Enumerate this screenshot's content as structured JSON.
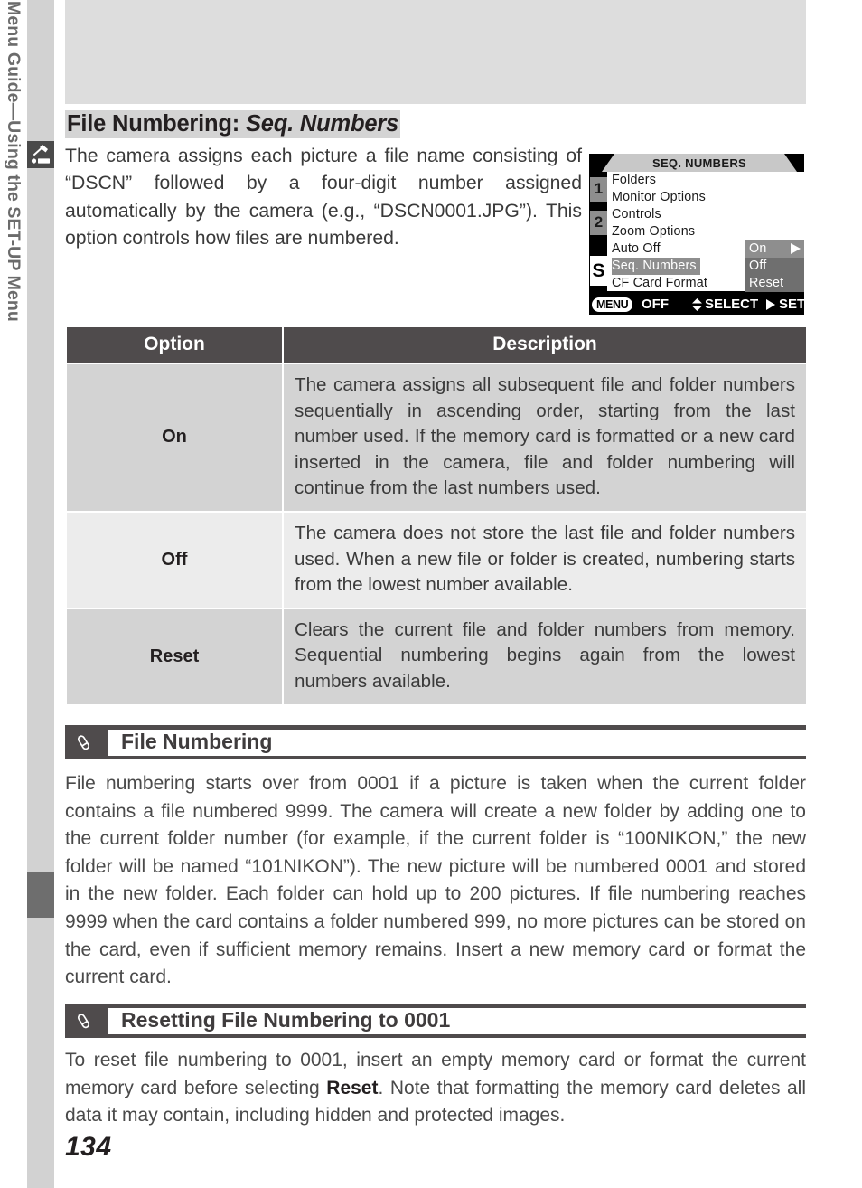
{
  "sidebar": {
    "icon": "setup-wrench-icon",
    "label": "Menu Guide—Using the SET-UP Menu"
  },
  "page": {
    "number": "134"
  },
  "section": {
    "title_plain": "File Numbering: ",
    "title_italic": "Seq. Numbers",
    "intro": "The camera assigns each picture a file name consisting of “DSCN” followed by a four-digit number assigned automatically by the camera (e.g., “DSCN0001.JPG”).  This option controls how files are numbered."
  },
  "lcd": {
    "title": "SEQ. NUMBERS",
    "tabs": [
      "1",
      "2",
      "S"
    ],
    "menu_items": [
      "Folders",
      "Monitor Options",
      "Controls",
      "Zoom Options",
      "Auto Off",
      "Seq. Numbers",
      "CF Card Format"
    ],
    "selected_item": "Seq. Numbers",
    "values": [
      "On",
      "Off",
      "Reset"
    ],
    "highlighted_value": "On",
    "status": {
      "menu_pill": "MENU",
      "off_label": "OFF",
      "select_label": "SELECT",
      "set_label": "SET"
    }
  },
  "table": {
    "headers": [
      "Option",
      "Description"
    ],
    "rows": [
      {
        "option": "On",
        "description": "The camera assigns all subsequent file and folder numbers sequentially in ascending order, starting from the last number used. If the memory card is formatted or a new card inserted in the camera, file and folder numbering will continue from the last numbers used."
      },
      {
        "option": "Off",
        "description": "The camera does not store the last file and folder numbers used. When a new file or folder is created, numbering starts from the lowest number available."
      },
      {
        "option": "Reset",
        "description": "Clears the current file and folder numbers from memory. Sequential numbering begins again from the lowest numbers available."
      }
    ]
  },
  "notes": [
    {
      "icon": "pencil-note-icon",
      "title": "File Numbering",
      "body_part1": "File numbering starts over from 0001 if a picture is taken when the current folder contains a file numbered 9999.  The camera will create a new folder by adding one to the current folder number (for example, if the current folder is “100NIKON,” the new folder will be named “101NIKON”).  The new picture will be numbered 0001 and stored in the new folder.  Each folder can hold up to 200 pictures.  If file numbering reaches 9999 when the card contains a folder numbered 999, no more pictures can be stored on the card, even if sufficient memory remains.  Insert a new memory card or format the current card."
    },
    {
      "icon": "pencil-note-icon",
      "title": "Resetting File Numbering to 0001",
      "body_part1": "To reset file numbering to 0001, insert an empty memory card or format the current memory card before selecting ",
      "body_bold": "Reset",
      "body_part2": ".  Note that formatting the memory card deletes all data it may contain, including hidden and protected images."
    }
  ],
  "colors": {
    "sidebar_bg": "#d2d2d2",
    "header_bar": "#4f4b4c",
    "row_shade": "#d3d3d3",
    "row_light": "#ececec",
    "lcd_black": "#000000",
    "lcd_highlight": "#8e8e8e"
  }
}
